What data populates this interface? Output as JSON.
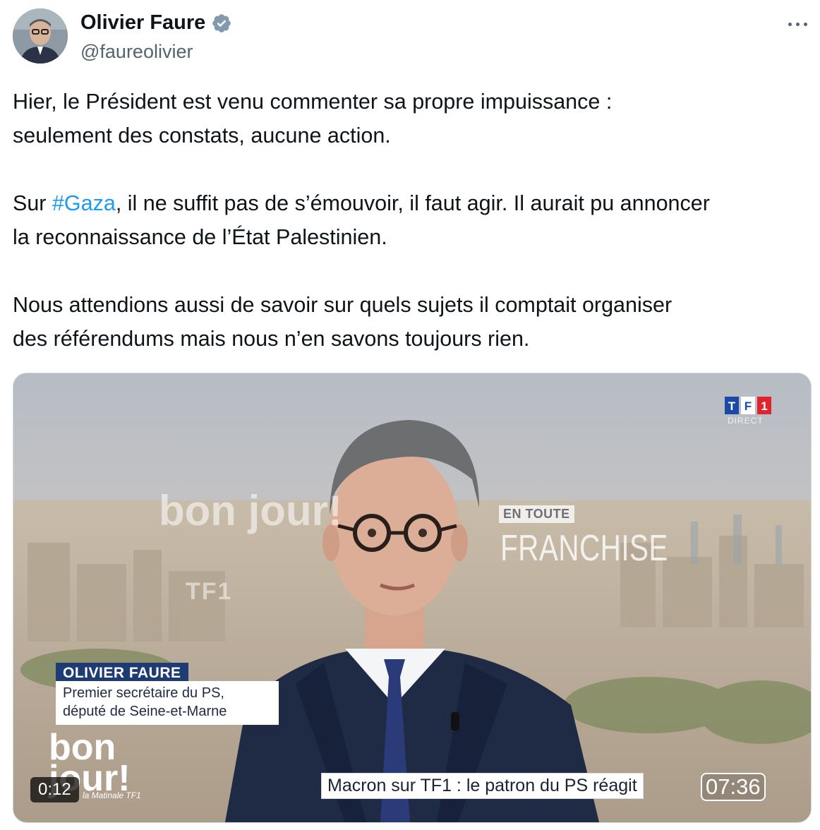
{
  "author": {
    "display_name": "Olivier Faure",
    "handle": "@faureolivier",
    "verified": true,
    "verified_color": "#829aab"
  },
  "icons": {
    "more": "more-horizontal-icon",
    "verified": "verified-badge-icon"
  },
  "tweet": {
    "p1_line1": "Hier, le Président est venu commenter sa propre impuissance :",
    "p1_line2": "seulement des constats, aucune action.",
    "p2_pre": "Sur ",
    "p2_hashtag": "#Gaza",
    "p2_post_line1": ", il ne suffit pas de s’émouvoir, il faut agir. Il aurait pu annoncer",
    "p2_line2": "la reconnaissance de l’État Palestinien.",
    "p3_line1": "Nous attendions aussi de savoir sur quels sujets il comptait organiser",
    "p3_line2": "des référendums mais nous n’en savons toujours rien.",
    "hashtag_color": "#1d9bf0"
  },
  "video": {
    "channel_logo": "TF1",
    "channel_status": "DIRECT",
    "bg_brand": "bon jour!",
    "bg_brand_sub": "TF1",
    "show_tag": "EN TOUTE",
    "show_name": "FRANCHISE",
    "lower_third_name": "OLIVIER FAURE",
    "lower_third_role_1": "Premier secrétaire du PS,",
    "lower_third_role_2": "député de Seine-et-Marne",
    "logo_line1": "bon",
    "logo_line2": "jour!",
    "logo_sub": "la Matinale TF1",
    "headline": "Macron sur TF1 : le patron du PS réagit",
    "clock": "07:36",
    "timestamp": "0:12"
  }
}
